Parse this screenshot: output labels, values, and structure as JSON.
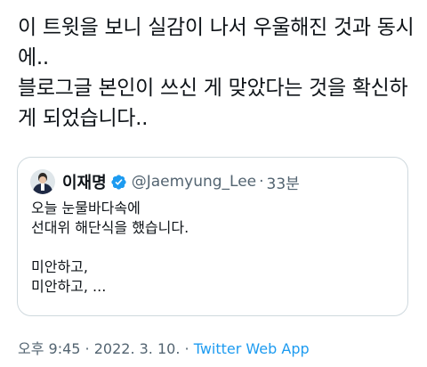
{
  "tweet": {
    "text": "이 트윗을 보니 실감이 나서 우울해진 것과 동시에..\n블로그글 본인이 쓰신 게 맞았다는 것을 확신하게 되었습니다..",
    "quoted": {
      "author_name": "이재명",
      "verified_icon": "verified-badge-icon",
      "handle": "@Jaemyung_Lee",
      "separator": "·",
      "time": "33분",
      "body": "오늘 눈물바다속에\n선대위 해단식을 했습니다.\n\n미안하고,\n미안하고, ..."
    },
    "meta": {
      "time": "오후 9:45",
      "dot1": " · ",
      "date": "2022. 3. 10.",
      "dot2": " · ",
      "source": "Twitter Web App"
    }
  },
  "colors": {
    "text": "#0f1419",
    "secondary": "#536471",
    "accent": "#1d9bf0",
    "border": "#cfd9de"
  }
}
